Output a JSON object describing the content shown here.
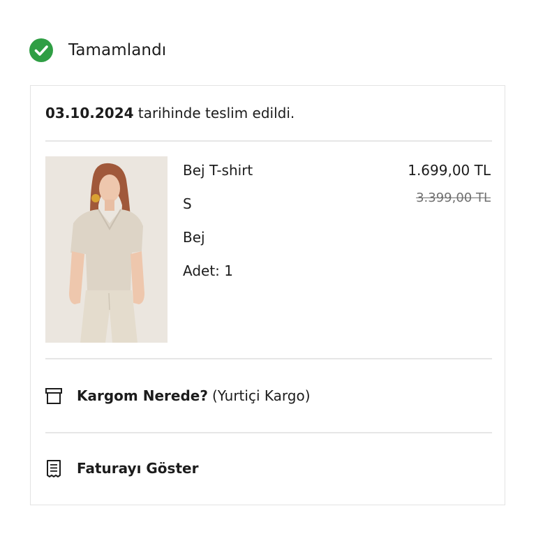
{
  "status": {
    "label": "Tamamlandı",
    "icon": "check-circle-icon",
    "color": "#2f9e44"
  },
  "order": {
    "delivery_date": "03.10.2024",
    "delivery_suffix": " tarihinde teslim edildi.",
    "item": {
      "name": "Bej T-shirt",
      "size": "S",
      "color": "Bej",
      "quantity": "Adet: 1",
      "price": "1.699,00 TL",
      "original_price": "3.399,00 TL",
      "image_icon": "product-photo"
    }
  },
  "actions": {
    "track": {
      "label": "Kargom Nerede?",
      "carrier": "(Yurtiçi Kargo)",
      "icon": "package-icon"
    },
    "invoice": {
      "label": "Faturayı Göster",
      "icon": "receipt-icon"
    }
  }
}
